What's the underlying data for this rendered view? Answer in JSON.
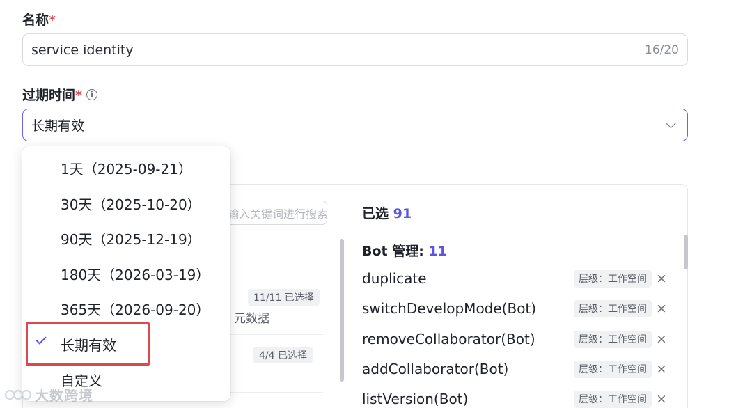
{
  "form": {
    "name_label": "名称",
    "required_mark": "*",
    "name_value": "service identity",
    "name_count": "16/20",
    "expiry_label": "过期时间",
    "expiry_info_icon": "ⓘ",
    "expiry_value": "长期有效"
  },
  "dropdown": {
    "options": [
      "1天（2025-09-21）",
      "30天（2025-10-20）",
      "90天（2025-12-19）",
      "180天（2026-03-19）",
      "365天（2026-09-20）",
      "长期有效",
      "自定义"
    ],
    "selected_index": 5
  },
  "left_panel": {
    "search_placeholder": "输入关键词进行搜索",
    "group1_tag": "11/11 已选择",
    "group1_sub": "元数据",
    "group2_tag": "4/4 已选择"
  },
  "right_panel": {
    "selected_label": "已选",
    "selected_count": "91",
    "group_label": "Bot 管理:",
    "group_count": "11",
    "items": [
      {
        "name": "duplicate",
        "tag": "层级：工作空间"
      },
      {
        "name": "switchDevelopMode(Bot)",
        "tag": "层级：工作空间"
      },
      {
        "name": "removeCollaborator(Bot)",
        "tag": "层级：工作空间"
      },
      {
        "name": "addCollaborator(Bot)",
        "tag": "层级：工作空间"
      },
      {
        "name": "listVersion(Bot)",
        "tag": "层级：工作空间"
      }
    ],
    "remove_icon": "×"
  },
  "colors": {
    "accent": "#5b55e0",
    "required": "#e5484d",
    "highlight_box": "#e0474c"
  },
  "icons": [
    "info-icon",
    "chevron-down-icon",
    "check-icon",
    "close-icon"
  ],
  "watermark": "大数跨境"
}
